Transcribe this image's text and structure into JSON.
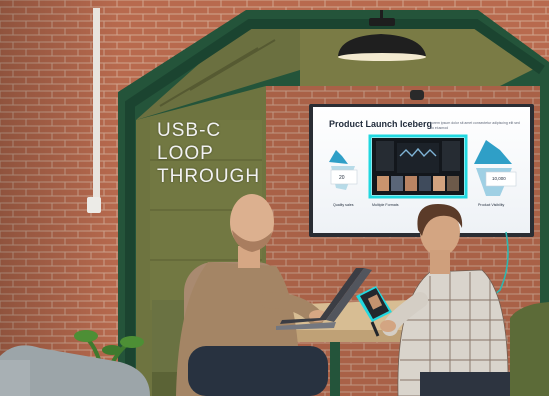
{
  "caption": {
    "text": "USB-C\nLOOP\nTHROUGH"
  },
  "tv_slide": {
    "title": "Product Launch Iceberg",
    "subtitle": "Lorem ipsum dolor sit amet consectetur adipiscing elit sed do eiusmod",
    "left_label": "Quality sales",
    "mid_label": "Multiple Formats",
    "right_label": "Product Visibility",
    "left_metric": "20",
    "right_metric": "10,000"
  },
  "colors": {
    "brick": "#b86a4e",
    "booth_frame": "#24543a",
    "booth_felt": "#6e7440",
    "screen_highlight": "#21d8e0",
    "table": "#d7bd93"
  }
}
